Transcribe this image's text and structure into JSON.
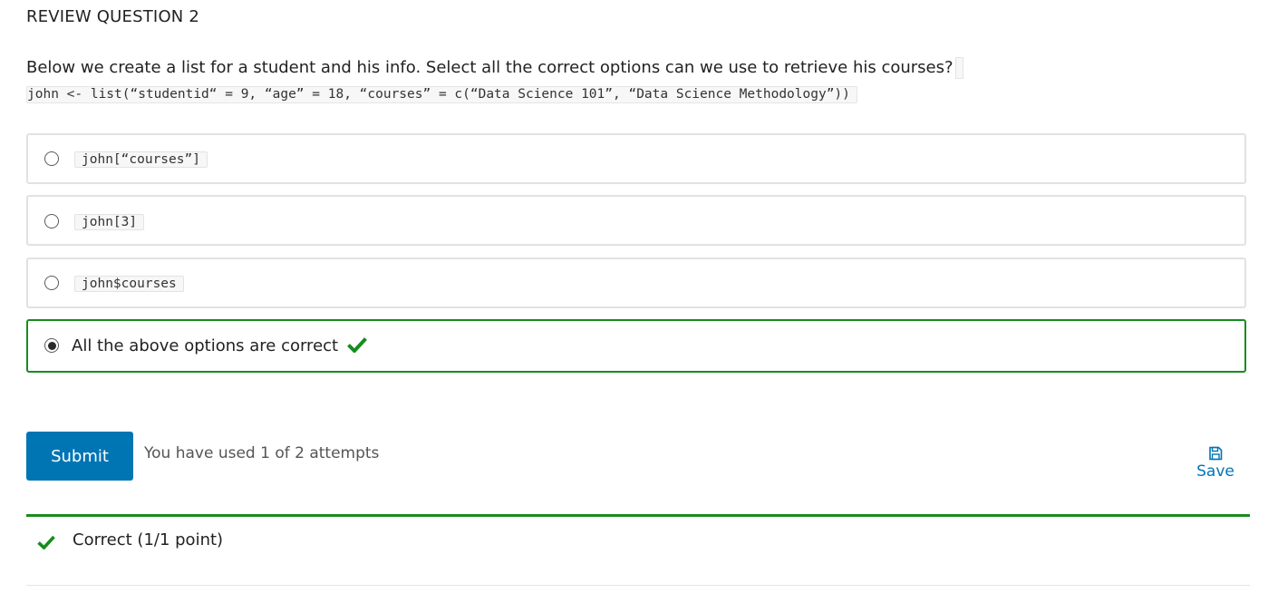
{
  "problem": {
    "title": "REVIEW QUESTION 2",
    "prompt": "Below we create a list for a student and his info. Select all the correct options can we use to retrieve his courses?",
    "code": "john <- list(“studentid“ = 9, “age” = 18, “courses” = c(“Data Science 101”, “Data Science Methodology”))"
  },
  "options": [
    {
      "label": "john[“courses”]",
      "is_code": true,
      "selected": false
    },
    {
      "label": "john[3]",
      "is_code": true,
      "selected": false
    },
    {
      "label": "john$courses",
      "is_code": true,
      "selected": false
    },
    {
      "label": "All the above options are correct",
      "is_code": false,
      "selected": true,
      "status_icon": "check-icon"
    }
  ],
  "actions": {
    "submit_label": "Submit",
    "attempts_text": "You have used 1 of 2 attempts",
    "save_label": "Save",
    "save_icon": "save-icon"
  },
  "feedback": {
    "icon": "check-icon",
    "text": "Correct (1/1 point)"
  },
  "colors": {
    "accent": "#0075b4",
    "correct": "#178c1f",
    "border": "#e2e2e2"
  }
}
